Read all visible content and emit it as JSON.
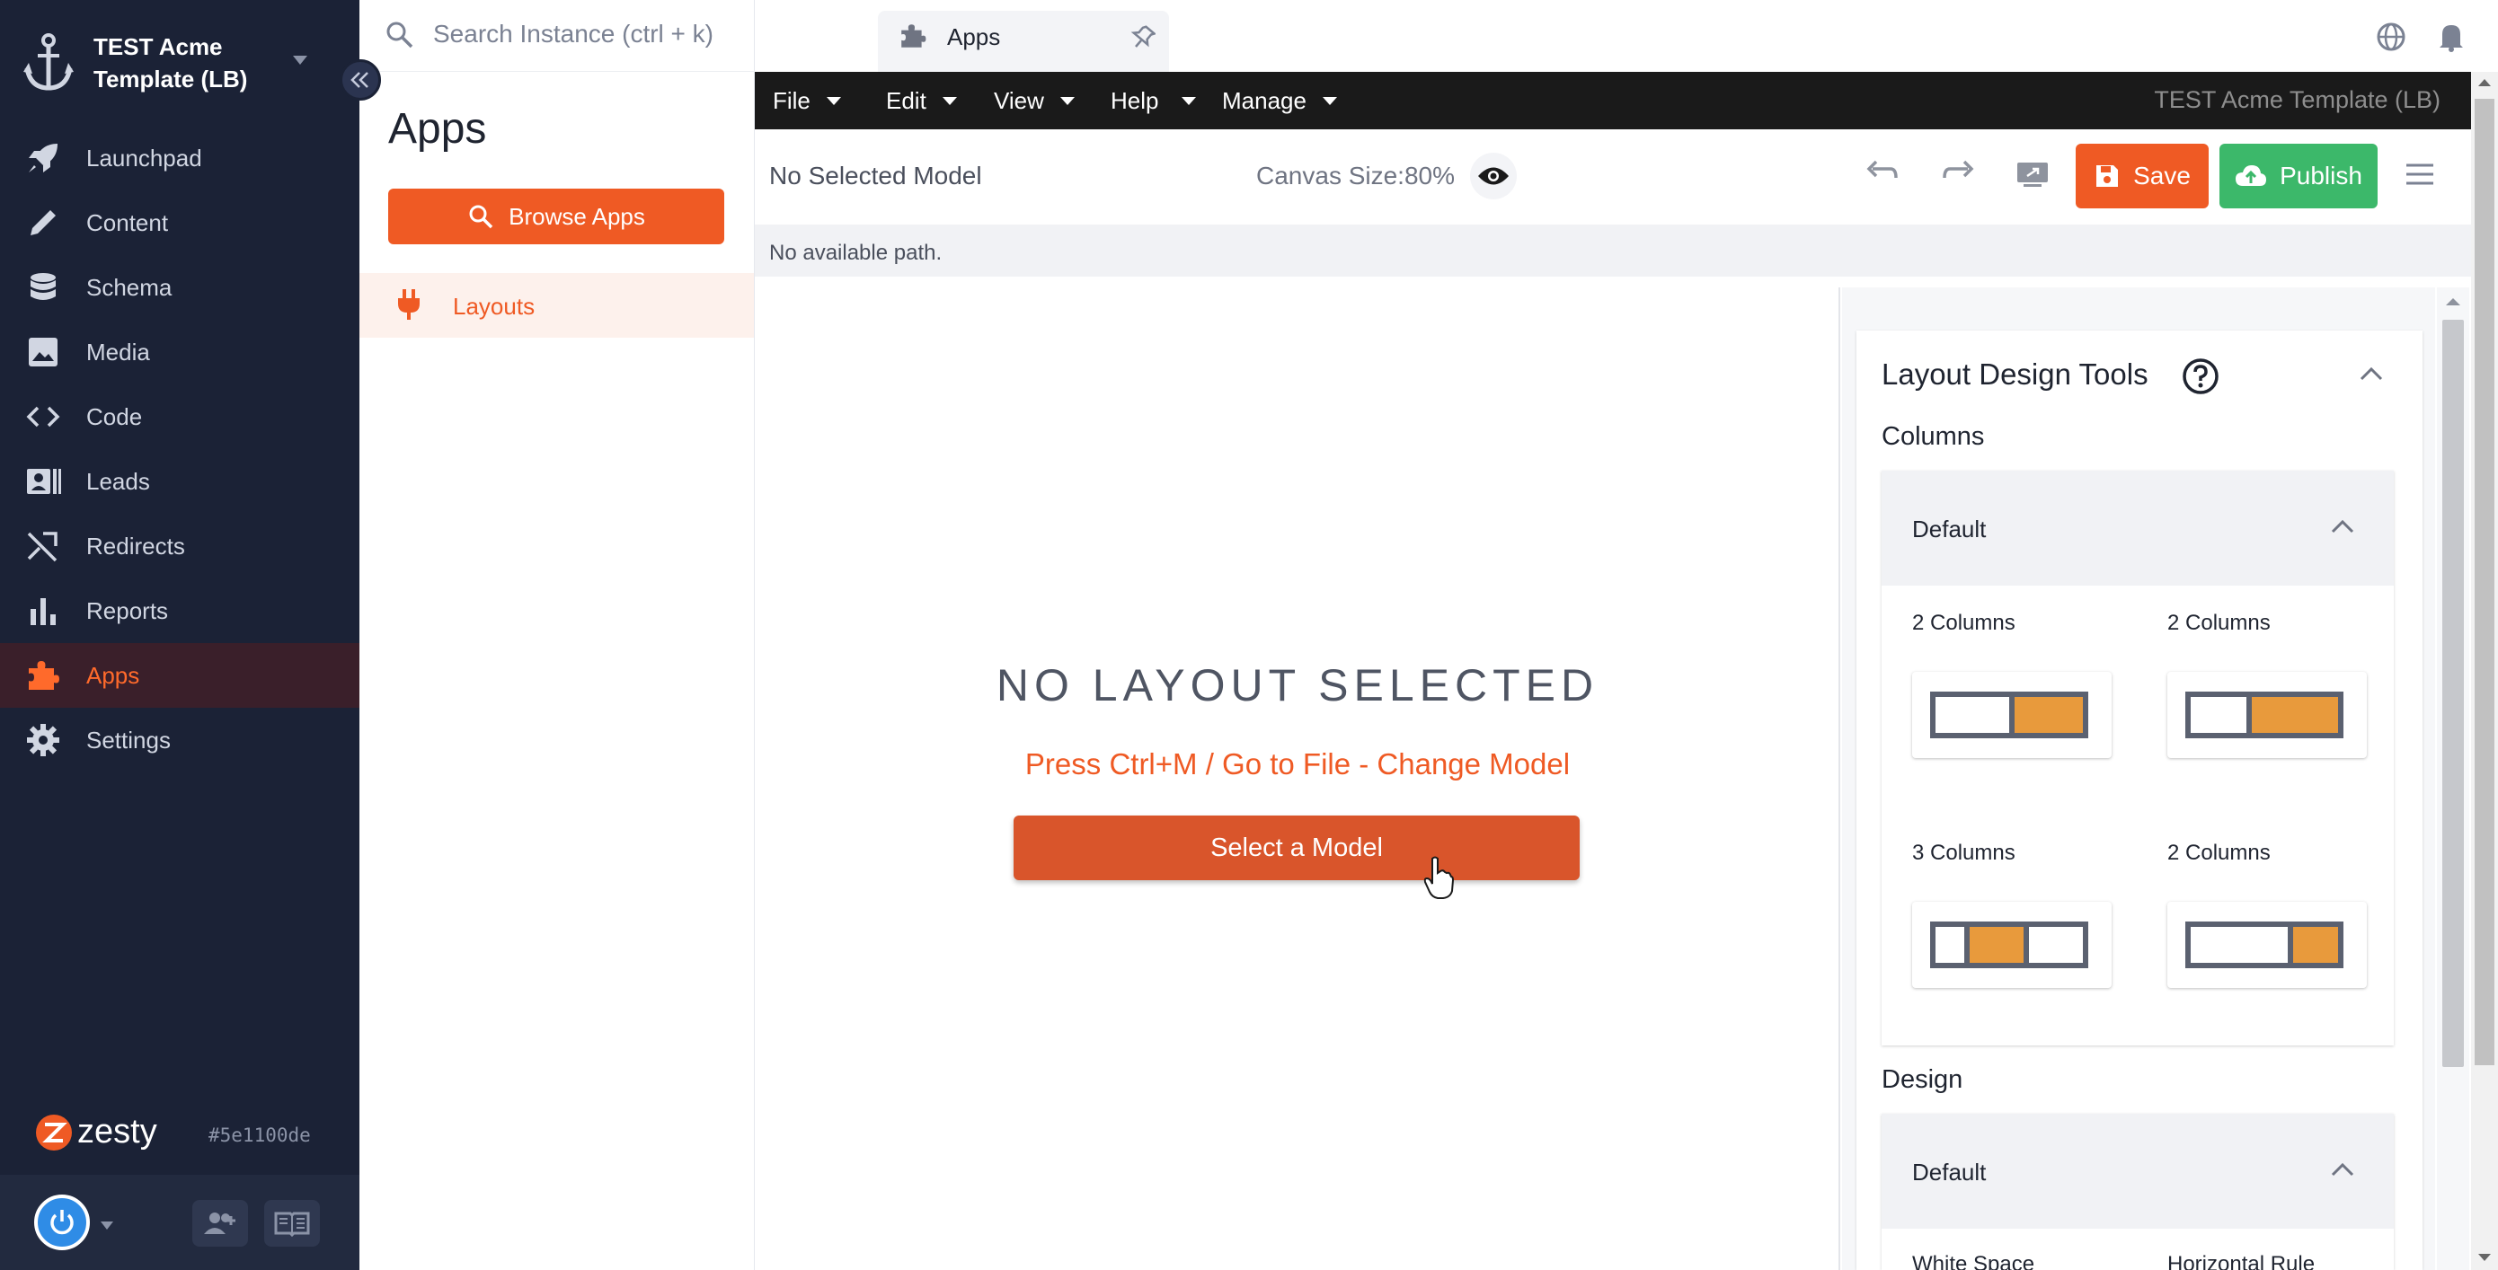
{
  "instance": {
    "name": "TEST Acme Template (LB)"
  },
  "sidebar": {
    "items": [
      {
        "label": "Launchpad",
        "icon": "rocket-icon"
      },
      {
        "label": "Content",
        "icon": "pencil-icon"
      },
      {
        "label": "Schema",
        "icon": "database-icon"
      },
      {
        "label": "Media",
        "icon": "image-icon"
      },
      {
        "label": "Code",
        "icon": "code-icon"
      },
      {
        "label": "Leads",
        "icon": "contact-card-icon"
      },
      {
        "label": "Redirects",
        "icon": "shuffle-icon"
      },
      {
        "label": "Reports",
        "icon": "bar-chart-icon"
      },
      {
        "label": "Apps",
        "icon": "puzzle-icon",
        "active": true
      },
      {
        "label": "Settings",
        "icon": "gear-icon"
      }
    ],
    "logo_text": "zesty",
    "build_hash": "#5e1100de"
  },
  "search": {
    "placeholder": "Search Instance (ctrl + k)"
  },
  "apps_panel": {
    "title": "Apps",
    "browse_label": "Browse Apps",
    "items": [
      {
        "label": "Layouts",
        "icon": "plug-icon"
      }
    ]
  },
  "tabs": [
    {
      "label": "Apps",
      "icon": "puzzle-icon"
    }
  ],
  "menubar": {
    "items": [
      "File",
      "Edit",
      "View",
      "Help",
      "Manage"
    ],
    "instance_label": "TEST Acme Template (LB)"
  },
  "toolbar": {
    "model_label": "No Selected Model",
    "canvas_size_label": "Canvas Size:80%",
    "save_label": "Save",
    "publish_label": "Publish"
  },
  "path": {
    "text": "No available path."
  },
  "canvas": {
    "heading": "NO LAYOUT SELECTED",
    "hint": "Press Ctrl+M / Go to File - Change Model",
    "select_label": "Select a Model"
  },
  "design_tools": {
    "title": "Layout Design Tools",
    "columns_title": "Columns",
    "columns_group": "Default",
    "column_options": [
      {
        "label": "2 Columns"
      },
      {
        "label": "2 Columns"
      },
      {
        "label": "3 Columns"
      },
      {
        "label": "2 Columns"
      }
    ],
    "design_title": "Design",
    "design_group": "Default",
    "design_options": [
      "White Space",
      "Horizontal Rule"
    ]
  },
  "colors": {
    "sidebar_bg": "#1b2236",
    "accent": "#ef5a24",
    "publish": "#3cb86a",
    "menubar_bg": "#1a1a1a",
    "column_fill": "#e89a3c",
    "column_frame": "#5b6170"
  }
}
